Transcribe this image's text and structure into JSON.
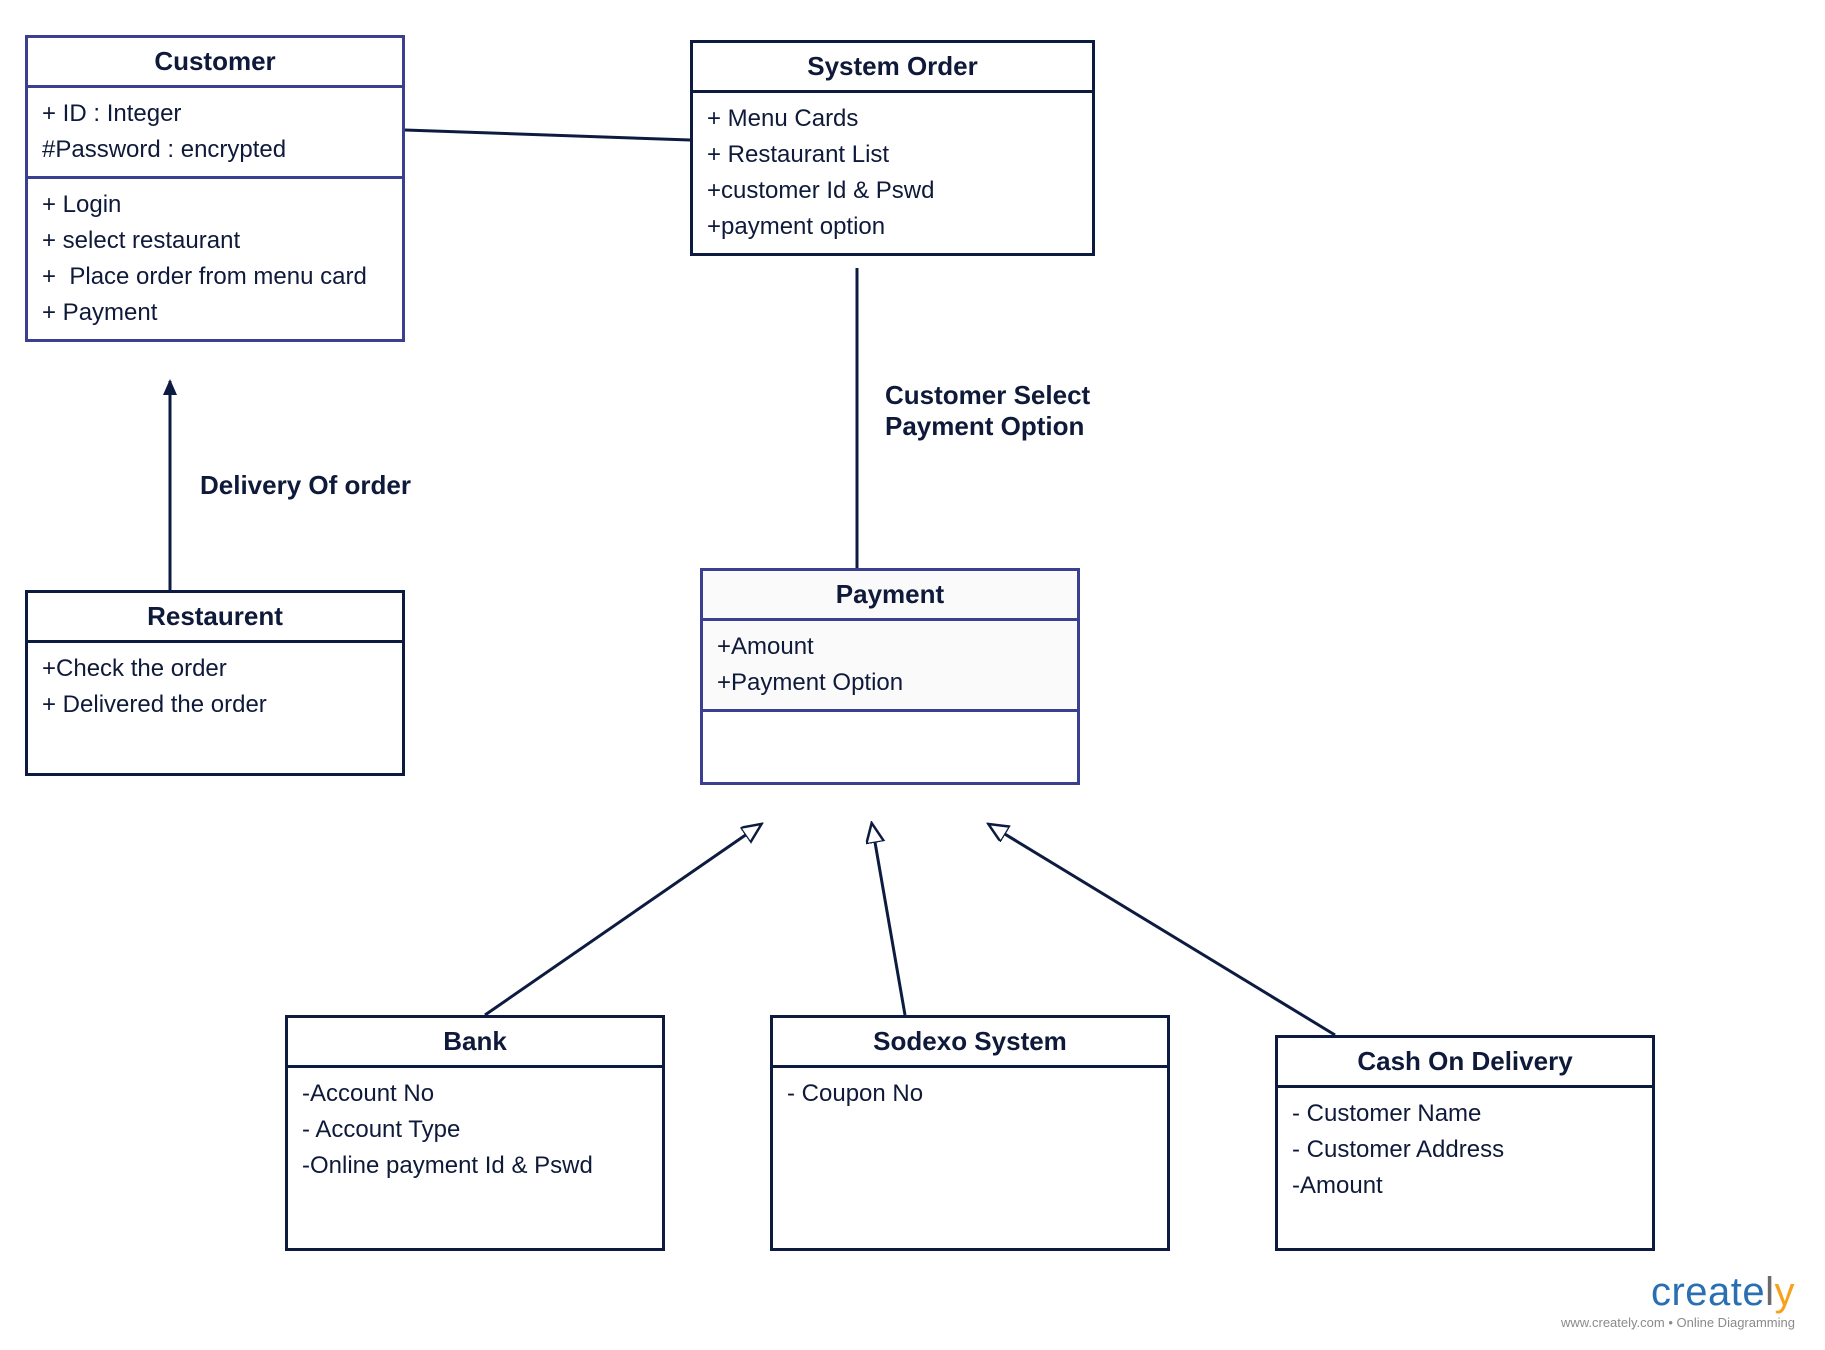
{
  "classes": {
    "customer": {
      "name": "Customer",
      "attributes": [
        "+ ID : Integer",
        "#Password : encrypted"
      ],
      "methods": [
        "+ Login",
        "+ select restaurant",
        "+  Place order from menu card",
        "+ Payment"
      ]
    },
    "system_order": {
      "name": "System Order",
      "attributes": [
        "+ Menu Cards",
        "+ Restaurant List",
        "+customer Id & Pswd",
        "+payment option"
      ]
    },
    "restaurant": {
      "name": "Restaurent",
      "attributes": [
        "+Check the order",
        "+ Delivered the order"
      ]
    },
    "payment": {
      "name": "Payment",
      "attributes": [
        "+Amount",
        "+Payment Option"
      ]
    },
    "bank": {
      "name": "Bank",
      "attributes": [
        "-Account No",
        "- Account Type",
        "-Online payment Id & Pswd"
      ]
    },
    "sodexo": {
      "name": "Sodexo System",
      "attributes": [
        "- Coupon No"
      ]
    },
    "cod": {
      "name": "Cash On Delivery",
      "attributes": [
        "- Customer Name",
        "- Customer Address",
        "-Amount"
      ]
    }
  },
  "edges": {
    "delivery": "Delivery Of order",
    "select_payment": "Customer Select\nPayment Option"
  },
  "branding": {
    "name_parts": [
      "create",
      "l",
      "y"
    ],
    "tagline": "www.creately.com • Online Diagramming"
  }
}
